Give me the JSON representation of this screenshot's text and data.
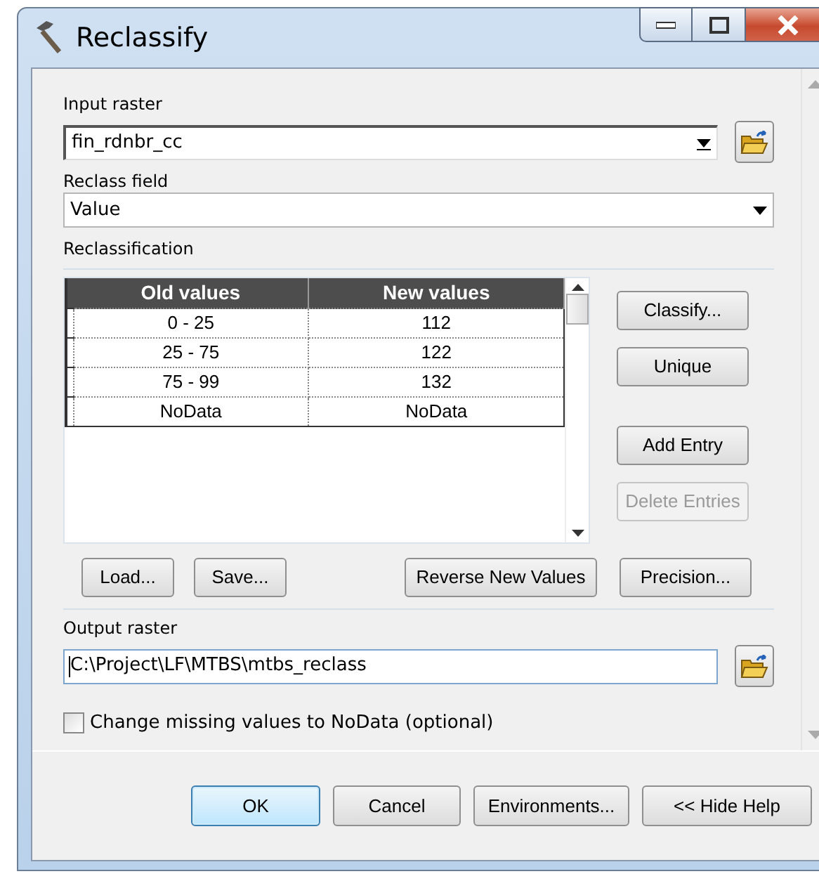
{
  "window": {
    "title": "Reclassify"
  },
  "input_raster": {
    "label": "Input raster",
    "value": "fin_rdnbr_cc"
  },
  "reclass_field": {
    "label": "Reclass field",
    "value": "Value"
  },
  "reclassification": {
    "label": "Reclassification",
    "columns": [
      "Old values",
      "New values"
    ],
    "rows": [
      [
        "0 - 25",
        "112"
      ],
      [
        "25 - 75",
        "122"
      ],
      [
        "75 - 99",
        "132"
      ],
      [
        "NoData",
        "NoData"
      ]
    ],
    "side_buttons": [
      {
        "label": "Classify...",
        "disabled": false,
        "gap_before": false
      },
      {
        "label": "Unique",
        "disabled": false,
        "gap_before": false
      },
      {
        "label": "Add Entry",
        "disabled": false,
        "gap_before": true
      },
      {
        "label": "Delete Entries",
        "disabled": true,
        "gap_before": false
      }
    ],
    "bottom_buttons": [
      {
        "label": "Load..."
      },
      {
        "label": "Save..."
      },
      {
        "label": "Reverse New Values"
      },
      {
        "label": "Precision..."
      }
    ]
  },
  "output_raster": {
    "label": "Output raster",
    "value": "C:\\Project\\LF\\MTBS\\mtbs_reclass"
  },
  "change_missing": {
    "label": "Change missing values to NoData (optional)",
    "checked": false
  },
  "footer_buttons": [
    {
      "label": "OK",
      "default": true
    },
    {
      "label": "Cancel",
      "default": false
    },
    {
      "label": "Environments...",
      "default": false
    },
    {
      "label": "<< Hide Help",
      "default": false
    }
  ]
}
